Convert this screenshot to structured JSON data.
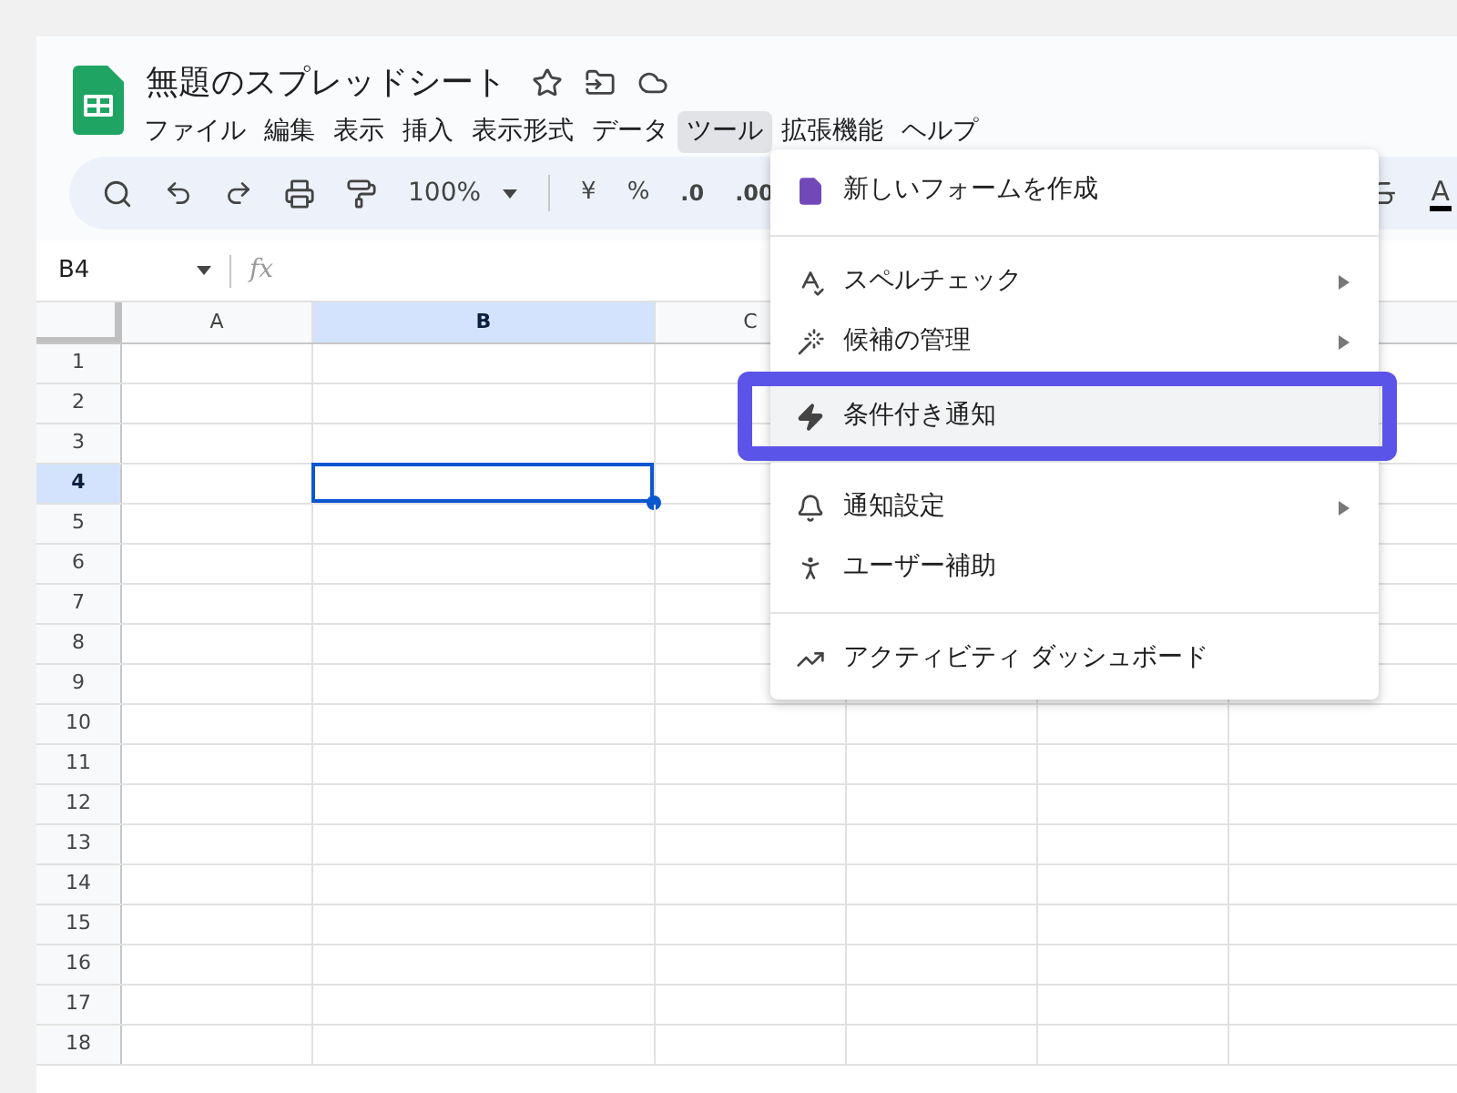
{
  "document": {
    "title": "無題のスプレッドシート"
  },
  "menubar": [
    {
      "label": "ファイル",
      "selected": false
    },
    {
      "label": "編集",
      "selected": false
    },
    {
      "label": "表示",
      "selected": false
    },
    {
      "label": "挿入",
      "selected": false
    },
    {
      "label": "表示形式",
      "selected": false
    },
    {
      "label": "データ",
      "selected": false
    },
    {
      "label": "ツール",
      "selected": true
    },
    {
      "label": "拡張機能",
      "selected": false
    },
    {
      "label": "ヘルプ",
      "selected": false
    }
  ],
  "toolbar": {
    "zoom": "100%",
    "currency": "¥",
    "percent": "%",
    "decrease_decimal": ".0",
    "increase_decimal": ".00",
    "text_color": "A"
  },
  "formula_bar": {
    "name_box": "B4",
    "fx": "fx"
  },
  "grid": {
    "columns": [
      {
        "label": "A",
        "selected": false
      },
      {
        "label": "B",
        "selected": true
      },
      {
        "label": "C",
        "selected": false
      }
    ],
    "rows": [
      {
        "label": "1",
        "selected": false
      },
      {
        "label": "2",
        "selected": false
      },
      {
        "label": "3",
        "selected": false
      },
      {
        "label": "4",
        "selected": true
      },
      {
        "label": "5",
        "selected": false
      },
      {
        "label": "6",
        "selected": false
      },
      {
        "label": "7",
        "selected": false
      },
      {
        "label": "8",
        "selected": false
      },
      {
        "label": "9",
        "selected": false
      },
      {
        "label": "10",
        "selected": false
      },
      {
        "label": "11",
        "selected": false
      },
      {
        "label": "12",
        "selected": false
      },
      {
        "label": "13",
        "selected": false
      },
      {
        "label": "14",
        "selected": false
      },
      {
        "label": "15",
        "selected": false
      },
      {
        "label": "16",
        "selected": false
      },
      {
        "label": "17",
        "selected": false
      },
      {
        "label": "18",
        "selected": false
      }
    ]
  },
  "tools_menu": [
    {
      "kind": "item",
      "label": "新しいフォームを作成",
      "submenu": false,
      "selected": false,
      "annotated": false
    },
    {
      "kind": "divider"
    },
    {
      "kind": "item",
      "label": "スペルチェック",
      "submenu": true,
      "selected": false,
      "annotated": false
    },
    {
      "kind": "item",
      "label": "候補の管理",
      "submenu": true,
      "selected": false,
      "annotated": false
    },
    {
      "kind": "item",
      "label": "条件付き通知",
      "submenu": false,
      "selected": true,
      "annotated": true
    },
    {
      "kind": "divider"
    },
    {
      "kind": "item",
      "label": "通知設定",
      "submenu": true,
      "selected": false,
      "annotated": false
    },
    {
      "kind": "item",
      "label": "ユーザー補助",
      "submenu": false,
      "selected": false,
      "annotated": false
    },
    {
      "kind": "divider"
    },
    {
      "kind": "item",
      "label": "アクティビティ ダッシュボード",
      "submenu": false,
      "selected": false,
      "annotated": false
    }
  ]
}
